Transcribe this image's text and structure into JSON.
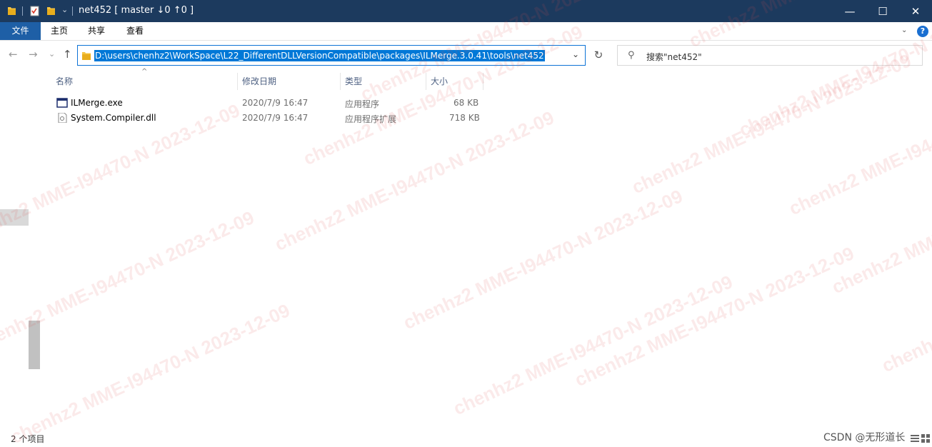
{
  "window": {
    "title": "net452 [ master ↓0 ↑0 ]",
    "minimize_glyph": "—",
    "maximize_glyph": "☐",
    "close_glyph": "✕"
  },
  "quick_access": {
    "icons": [
      "folder-icon",
      "properties-icon",
      "new-folder-icon",
      "dropdown-icon"
    ],
    "dropdown_glyph": "⌄"
  },
  "ribbon": {
    "tabs": [
      {
        "label": "文件",
        "active": true
      },
      {
        "label": "主页"
      },
      {
        "label": "共享"
      },
      {
        "label": "查看"
      }
    ],
    "expand_glyph": "⌄",
    "help_glyph": "?"
  },
  "nav": {
    "back_glyph": "←",
    "forward_glyph": "→",
    "recent_glyph": "⌄",
    "up_glyph": "↑",
    "address": "D:\\users\\chenhz2\\WorkSpace\\L22_DifferentDLLVersionCompatible\\packages\\ILMerge.3.0.41\\tools\\net452",
    "address_dropdown_glyph": "⌄",
    "refresh_glyph": "↻",
    "search_placeholder": "搜索\"net452\"",
    "search_glyph": "⚲"
  },
  "columns": {
    "name": "名称",
    "modified": "修改日期",
    "type": "类型",
    "size": "大小",
    "sort_glyph": "^"
  },
  "files": [
    {
      "name": "ILMerge.exe",
      "modified": "2020/7/9 16:47",
      "type": "应用程序",
      "size": "68 KB",
      "icon": "exe-icon"
    },
    {
      "name": "System.Compiler.dll",
      "modified": "2020/7/9 16:47",
      "type": "应用程序扩展",
      "size": "718 KB",
      "icon": "dll-icon"
    }
  ],
  "status": {
    "item_count": "2 个项目",
    "credit": "CSDN @无形道长"
  },
  "watermark": {
    "text": "chenhz2 MME-I94470-N 2023-12-09"
  },
  "colors": {
    "titlebar": "#1c3a5e",
    "file_tab": "#1e5fa6",
    "selection": "#0078d7",
    "address_border": "#0d73d6"
  }
}
